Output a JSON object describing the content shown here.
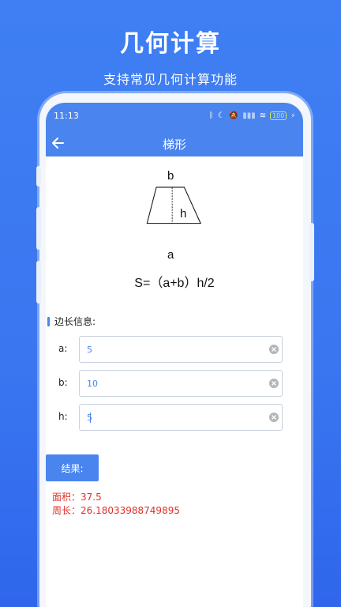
{
  "promo": {
    "title": "几何计算",
    "subtitle": "支持常见几何计算功能"
  },
  "status_bar": {
    "time": "11:13",
    "icons": [
      "bluetooth-icon",
      "moon-icon",
      "mute-icon",
      "signal-icon",
      "wifi-icon",
      "battery-icon",
      "charging-icon"
    ],
    "battery": "100"
  },
  "nav": {
    "back_icon": "back-arrow-icon",
    "title": "梯形"
  },
  "diagram": {
    "label_top": "b",
    "label_bottom": "a",
    "label_height": "h"
  },
  "formula": "S=（a+b）h/2",
  "section": {
    "title": "边长信息:"
  },
  "fields": [
    {
      "label": "a:",
      "value": "5"
    },
    {
      "label": "b:",
      "value": "10"
    },
    {
      "label": "h:",
      "value": "5"
    }
  ],
  "result": {
    "button_label": "结果:",
    "area": "面积：37.5",
    "perimeter": "周长：26.18033988749895"
  },
  "colors": {
    "background": "#3f7ff3",
    "header": "#4a85ef",
    "accent": "#4a85ef",
    "result_text": "#e0312a"
  }
}
